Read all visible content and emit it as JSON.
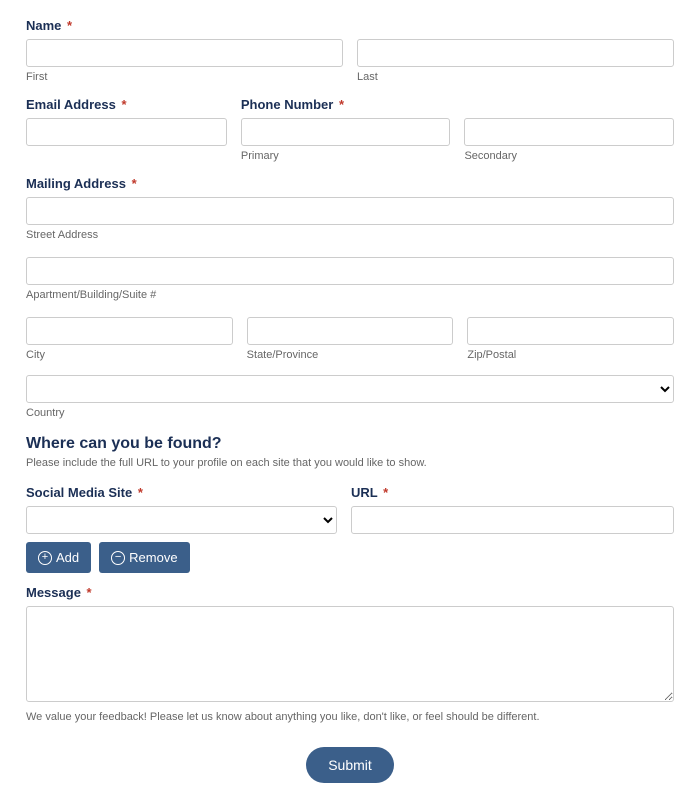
{
  "name": {
    "label": "Name",
    "required": "*",
    "first_sublabel": "First",
    "last_sublabel": "Last"
  },
  "email": {
    "label": "Email Address",
    "required": "*"
  },
  "phone": {
    "label": "Phone Number",
    "required": "*",
    "primary_sublabel": "Primary",
    "secondary_sublabel": "Secondary"
  },
  "address": {
    "label": "Mailing Address",
    "required": "*",
    "street_sublabel": "Street Address",
    "apt_sublabel": "Apartment/Building/Suite #",
    "city_sublabel": "City",
    "state_sublabel": "State/Province",
    "zip_sublabel": "Zip/Postal",
    "country_sublabel": "Country"
  },
  "social_section": {
    "heading": "Where can you be found?",
    "subtext": "Please include the full URL to your profile on each site that you would like to show."
  },
  "social_site": {
    "label": "Social Media Site",
    "required": "*"
  },
  "url": {
    "label": "URL",
    "required": "*"
  },
  "buttons": {
    "add": "Add",
    "remove": "Remove",
    "submit": "Submit"
  },
  "message": {
    "label": "Message",
    "required": "*",
    "helper": "We value your feedback! Please let us know about anything you like, don't like, or feel should be different."
  }
}
